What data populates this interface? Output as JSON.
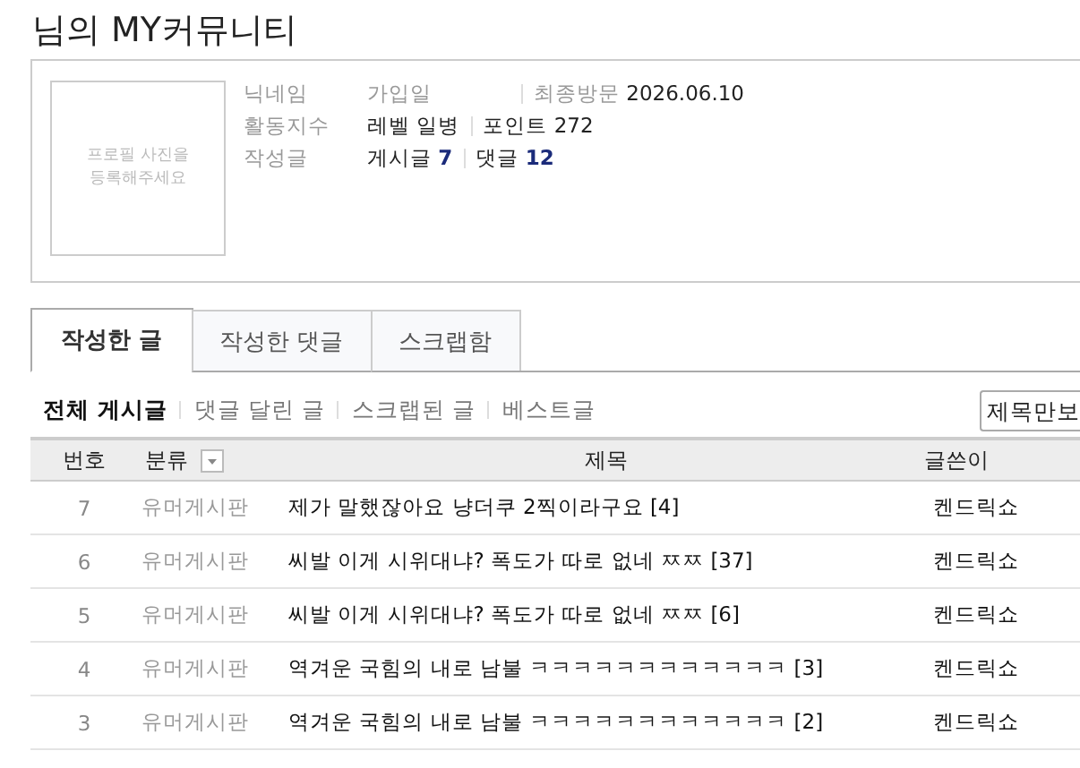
{
  "page_title": "님의 MY커뮤니티",
  "profile": {
    "photo_placeholder": [
      "프로필 사진을",
      "등록해주세요"
    ],
    "rows": [
      {
        "label": "닉네임",
        "parts": [
          {
            "kind": "muted",
            "name": "가입일"
          },
          {
            "kind": "muted",
            "name": "최종방문",
            "value": "2026.06.10"
          }
        ]
      },
      {
        "label": "활동지수",
        "parts": [
          {
            "kind": "plain",
            "name": "레벨 일병"
          },
          {
            "kind": "plain",
            "name": "포인트",
            "value": "272"
          }
        ]
      },
      {
        "label": "작성글",
        "parts": [
          {
            "kind": "count",
            "name": "게시글",
            "value": "7"
          },
          {
            "kind": "count",
            "name": "댓글",
            "value": "12"
          }
        ]
      }
    ]
  },
  "tabs": [
    {
      "label": "작성한 글",
      "selected": true
    },
    {
      "label": "작성한 댓글",
      "selected": false
    },
    {
      "label": "스크랩함",
      "selected": false
    }
  ],
  "filters": [
    {
      "label": "전체 게시글",
      "selected": true
    },
    {
      "label": "댓글 달린 글",
      "selected": false
    },
    {
      "label": "스크랩된 글",
      "selected": false
    },
    {
      "label": "베스트글",
      "selected": false
    }
  ],
  "view_select": {
    "value": "제목만보"
  },
  "table": {
    "columns": [
      {
        "label": "번호"
      },
      {
        "label": "분류",
        "kind": "filter"
      },
      {
        "label": "제목"
      },
      {
        "label": "글쓴이"
      }
    ],
    "rows": [
      {
        "number": "7",
        "category": "유머게시판",
        "title": "제가 말했잖아요 냥더쿠 2찍이라구요 [4]",
        "author": "켄드릭쇼"
      },
      {
        "number": "6",
        "category": "유머게시판",
        "title": "씨발 이게 시위대냐? 폭도가 따로 없네 ㅉㅉ [37]",
        "author": "켄드릭쇼"
      },
      {
        "number": "5",
        "category": "유머게시판",
        "title": "씨발 이게 시위대냐? 폭도가 따로 없네 ㅉㅉ [6]",
        "author": "켄드릭쇼"
      },
      {
        "number": "4",
        "category": "유머게시판",
        "title": "역겨운 국힘의 내로 남불 ㅋㅋㅋㅋㅋㅋㅋㅋㅋㅋㅋㅋ [3]",
        "author": "켄드릭쇼"
      },
      {
        "number": "3",
        "category": "유머게시판",
        "title": "역겨운 국힘의 내로 남불 ㅋㅋㅋㅋㅋㅋㅋㅋㅋㅋㅋㅋ [2]",
        "author": "켄드릭쇼"
      }
    ]
  }
}
